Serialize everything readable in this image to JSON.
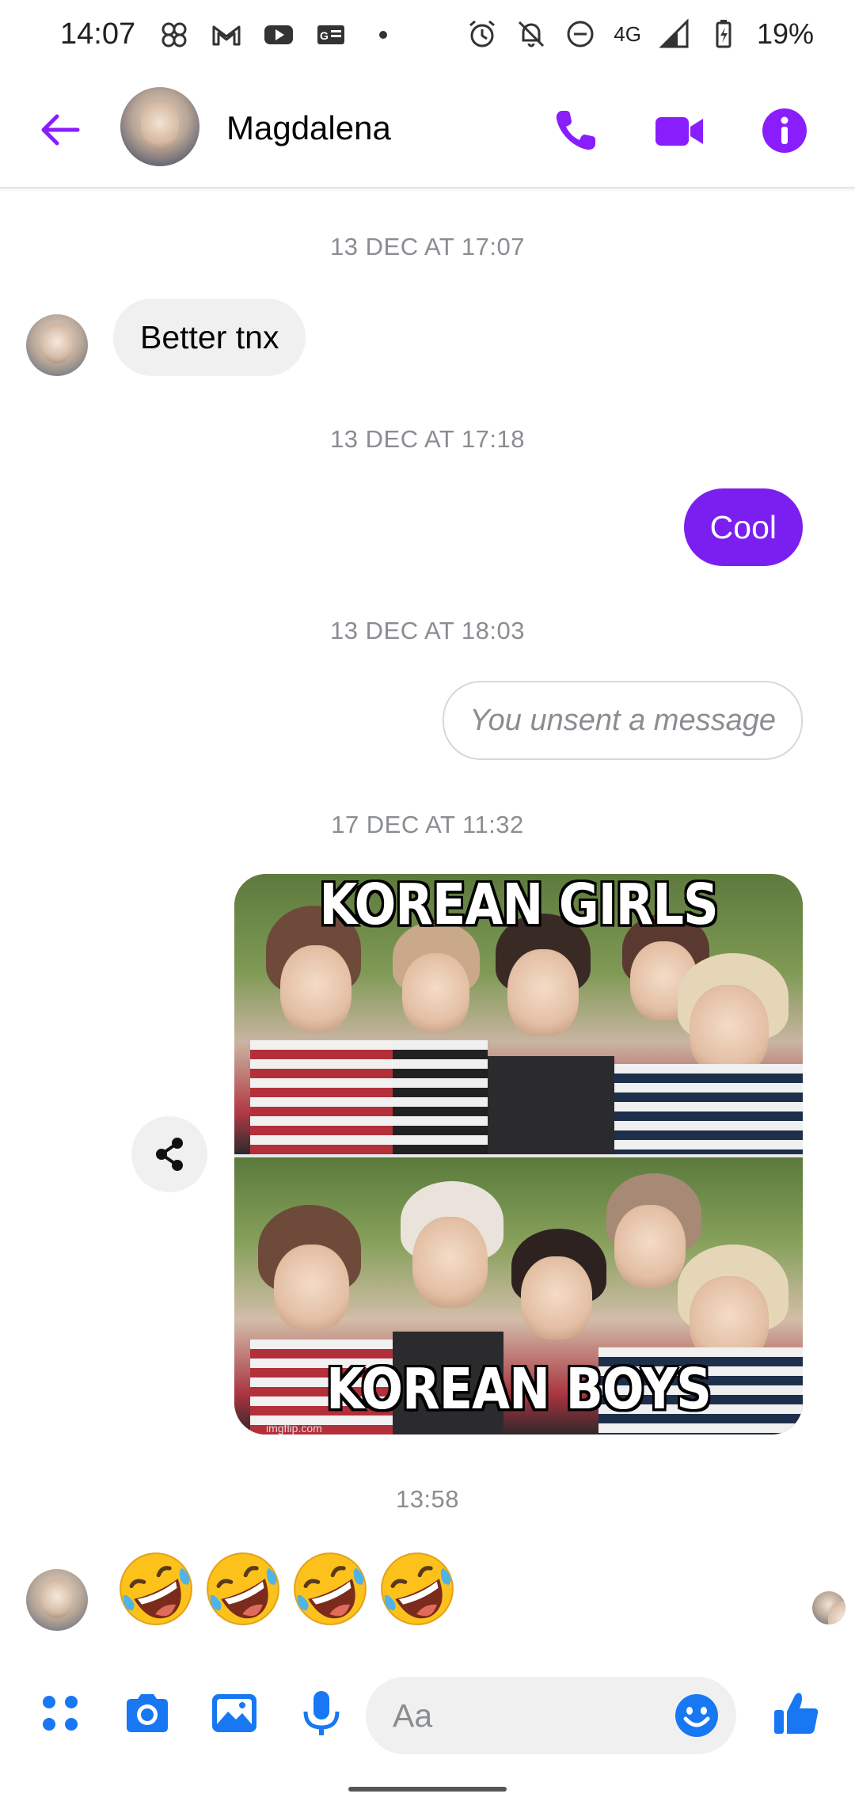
{
  "status_bar": {
    "time": "14:07",
    "network": "4G",
    "battery": "19%",
    "icons_left": [
      "apps-icon",
      "gmail-icon",
      "youtube-icon",
      "news-icon",
      "dot-icon"
    ],
    "icons_right": [
      "alarm-icon",
      "bell-off-icon",
      "dnd-icon",
      "signal-icon",
      "battery-icon"
    ]
  },
  "header": {
    "contact_name": "Magdalena",
    "accent_color": "#8a1dfc"
  },
  "messages": [
    {
      "type": "timestamp",
      "text": "13 DEC AT 17:07"
    },
    {
      "type": "incoming",
      "text": "Better tnx"
    },
    {
      "type": "timestamp",
      "text": "13 DEC AT 17:18"
    },
    {
      "type": "outgoing",
      "text": "Cool"
    },
    {
      "type": "timestamp",
      "text": "13 DEC AT 18:03"
    },
    {
      "type": "unsent",
      "text": "You unsent a message"
    },
    {
      "type": "timestamp",
      "text": "17 DEC AT 11:32"
    },
    {
      "type": "image",
      "top_caption": "KOREAN GIRLS",
      "bottom_caption": "KOREAN BOYS",
      "watermark": "imgflip.com"
    },
    {
      "type": "timestamp",
      "text": "13:58"
    },
    {
      "type": "emoji",
      "count": 4,
      "emoji_name": "rolling-on-floor-laughing"
    }
  ],
  "composer": {
    "placeholder": "Aa",
    "icons": [
      "apps-icon",
      "camera-icon",
      "gallery-icon",
      "mic-icon",
      "emoji-icon",
      "like-icon"
    ]
  }
}
